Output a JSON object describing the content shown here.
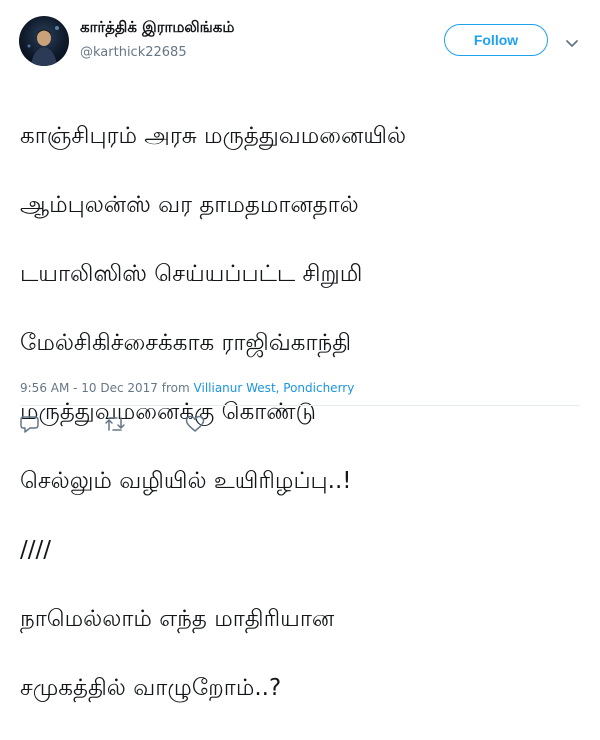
{
  "tweet": {
    "display_name": "கார்த்திக் இராமலிங்கம்",
    "handle": "@karthick22685",
    "follow_label": "Follow",
    "lines": [
      "காஞ்சிபுரம் அரசு மருத்துவமனையில்",
      "ஆம்புலன்ஸ் வர தாமதமானதால்",
      "டயாலிஸிஸ் செய்யப்பட்ட சிறுமி",
      "மேல்சிகிச்சைக்காக ராஜிவ்காந்தி",
      "மருத்துவமனைக்கு கொண்டு",
      "செல்லும் வழியில் உயிரிழப்பு..!",
      "////",
      "நாமெல்லாம் எந்த மாதிரியான",
      "சமுகத்தில் வாழுறோம்..?"
    ],
    "timestamp": "9:56 AM - 10 Dec 2017",
    "from_label": "from",
    "location": "Villianur West, Pondicherry"
  },
  "icons": {
    "menu": "chevron-down-icon",
    "reply": "reply-icon",
    "retweet": "retweet-icon",
    "like": "heart-icon"
  },
  "colors": {
    "accent": "#1da1f2",
    "link": "#1b95e0",
    "muted": "#657786",
    "text": "#14171a"
  }
}
